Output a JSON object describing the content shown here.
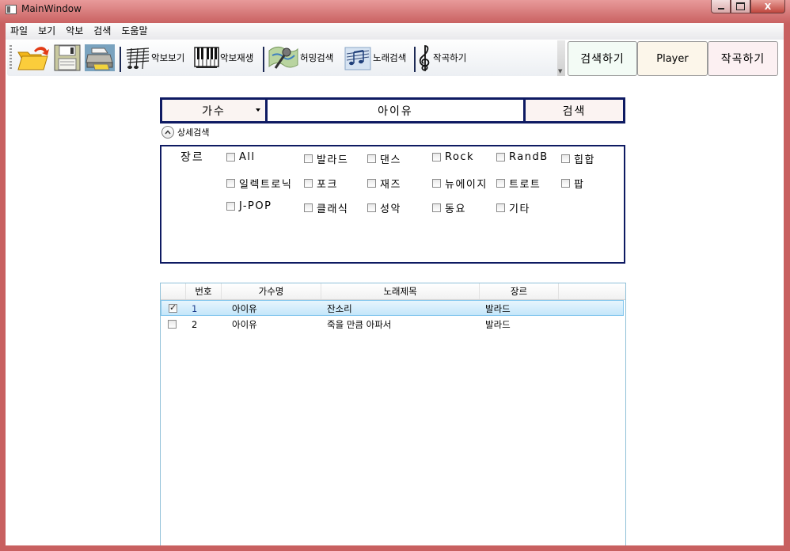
{
  "window": {
    "title": "MainWindow",
    "minimize": "—",
    "maximize": "□",
    "close": "X"
  },
  "menu": [
    "파일",
    "보기",
    "악보",
    "검색",
    "도움말"
  ],
  "toolbar": {
    "open_icon": "folder-open-icon",
    "save_icon": "floppy-disk-icon",
    "print_icon": "printer-icon",
    "score_view": "악보보기",
    "score_play": "악보재생",
    "humming_search": "허밍검색",
    "song_search": "노래검색",
    "compose": "작곡하기"
  },
  "big_buttons": {
    "search": "검색하기",
    "player": "Player",
    "compose": "작곡하기"
  },
  "colors": {
    "search_btn_bg": "#f3fbf5",
    "player_btn_bg": "#fcf6ea",
    "compose_btn_bg": "#fcf0f2",
    "border_navy": "#0e1a62"
  },
  "search": {
    "field": "가수",
    "query": "아이유",
    "button": "검색"
  },
  "detail": {
    "label": "상세검색",
    "genre_label": "장르",
    "genres": [
      {
        "label": "All",
        "checked": false
      },
      {
        "label": "발라드",
        "checked": false
      },
      {
        "label": "댄스",
        "checked": false
      },
      {
        "label": "Rock",
        "checked": false
      },
      {
        "label": "RandB",
        "checked": false
      },
      {
        "label": "힙합",
        "checked": false
      },
      {
        "label": "일렉트로닉",
        "checked": false
      },
      {
        "label": "포크",
        "checked": false
      },
      {
        "label": "재즈",
        "checked": false
      },
      {
        "label": "뉴에이지",
        "checked": false
      },
      {
        "label": "트로트",
        "checked": false
      },
      {
        "label": "팝",
        "checked": false
      },
      {
        "label": "J-POP",
        "checked": false
      },
      {
        "label": "클래식",
        "checked": false
      },
      {
        "label": "성악",
        "checked": false
      },
      {
        "label": "동요",
        "checked": false
      },
      {
        "label": "기타",
        "checked": false
      }
    ]
  },
  "grid": {
    "columns": [
      "번호",
      "가수명",
      "노래제목",
      "장르"
    ],
    "rows": [
      {
        "checked": true,
        "num": "1",
        "artist": "아이유",
        "title": "잔소리",
        "genre": "발라드",
        "selected": true
      },
      {
        "checked": false,
        "num": "2",
        "artist": "아이유",
        "title": "죽을 만큼 아파서",
        "genre": "발라드",
        "selected": false
      }
    ]
  }
}
